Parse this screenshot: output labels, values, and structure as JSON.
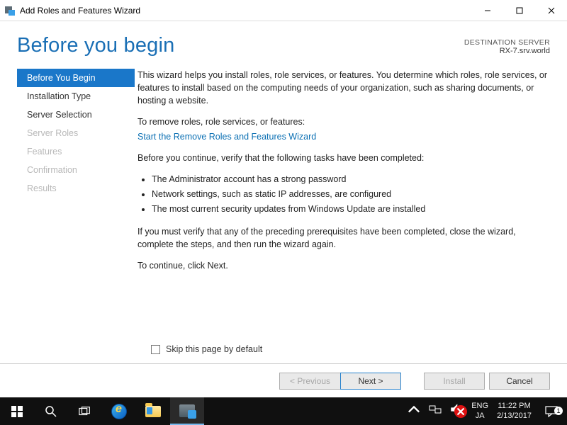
{
  "window": {
    "title": "Add Roles and Features Wizard"
  },
  "header": {
    "page_title": "Before you begin",
    "dest_label": "DESTINATION SERVER",
    "dest_server": "RX-7.srv.world"
  },
  "sidebar": {
    "items": [
      {
        "label": "Before You Begin",
        "state": "selected"
      },
      {
        "label": "Installation Type",
        "state": "normal"
      },
      {
        "label": "Server Selection",
        "state": "normal"
      },
      {
        "label": "Server Roles",
        "state": "disabled"
      },
      {
        "label": "Features",
        "state": "disabled"
      },
      {
        "label": "Confirmation",
        "state": "disabled"
      },
      {
        "label": "Results",
        "state": "disabled"
      }
    ]
  },
  "main": {
    "intro": "This wizard helps you install roles, role services, or features. You determine which roles, role services, or features to install based on the computing needs of your organization, such as sharing documents, or hosting a website.",
    "remove_label": "To remove roles, role services, or features:",
    "remove_link": "Start the Remove Roles and Features Wizard",
    "verify_intro": "Before you continue, verify that the following tasks have been completed:",
    "bullets": [
      "The Administrator account has a strong password",
      "Network settings, such as static IP addresses, are configured",
      "The most current security updates from Windows Update are installed"
    ],
    "prereq_close": "If you must verify that any of the preceding prerequisites have been completed, close the wizard, complete the steps, and then run the wizard again.",
    "continue_hint": "To continue, click Next.",
    "skip_label": "Skip this page by default"
  },
  "buttons": {
    "previous": "< Previous",
    "next": "Next >",
    "install": "Install",
    "cancel": "Cancel"
  },
  "taskbar": {
    "lang1": "ENG",
    "lang2": "JA",
    "time": "11:22 PM",
    "date": "2/13/2017",
    "notif_count": "1"
  }
}
